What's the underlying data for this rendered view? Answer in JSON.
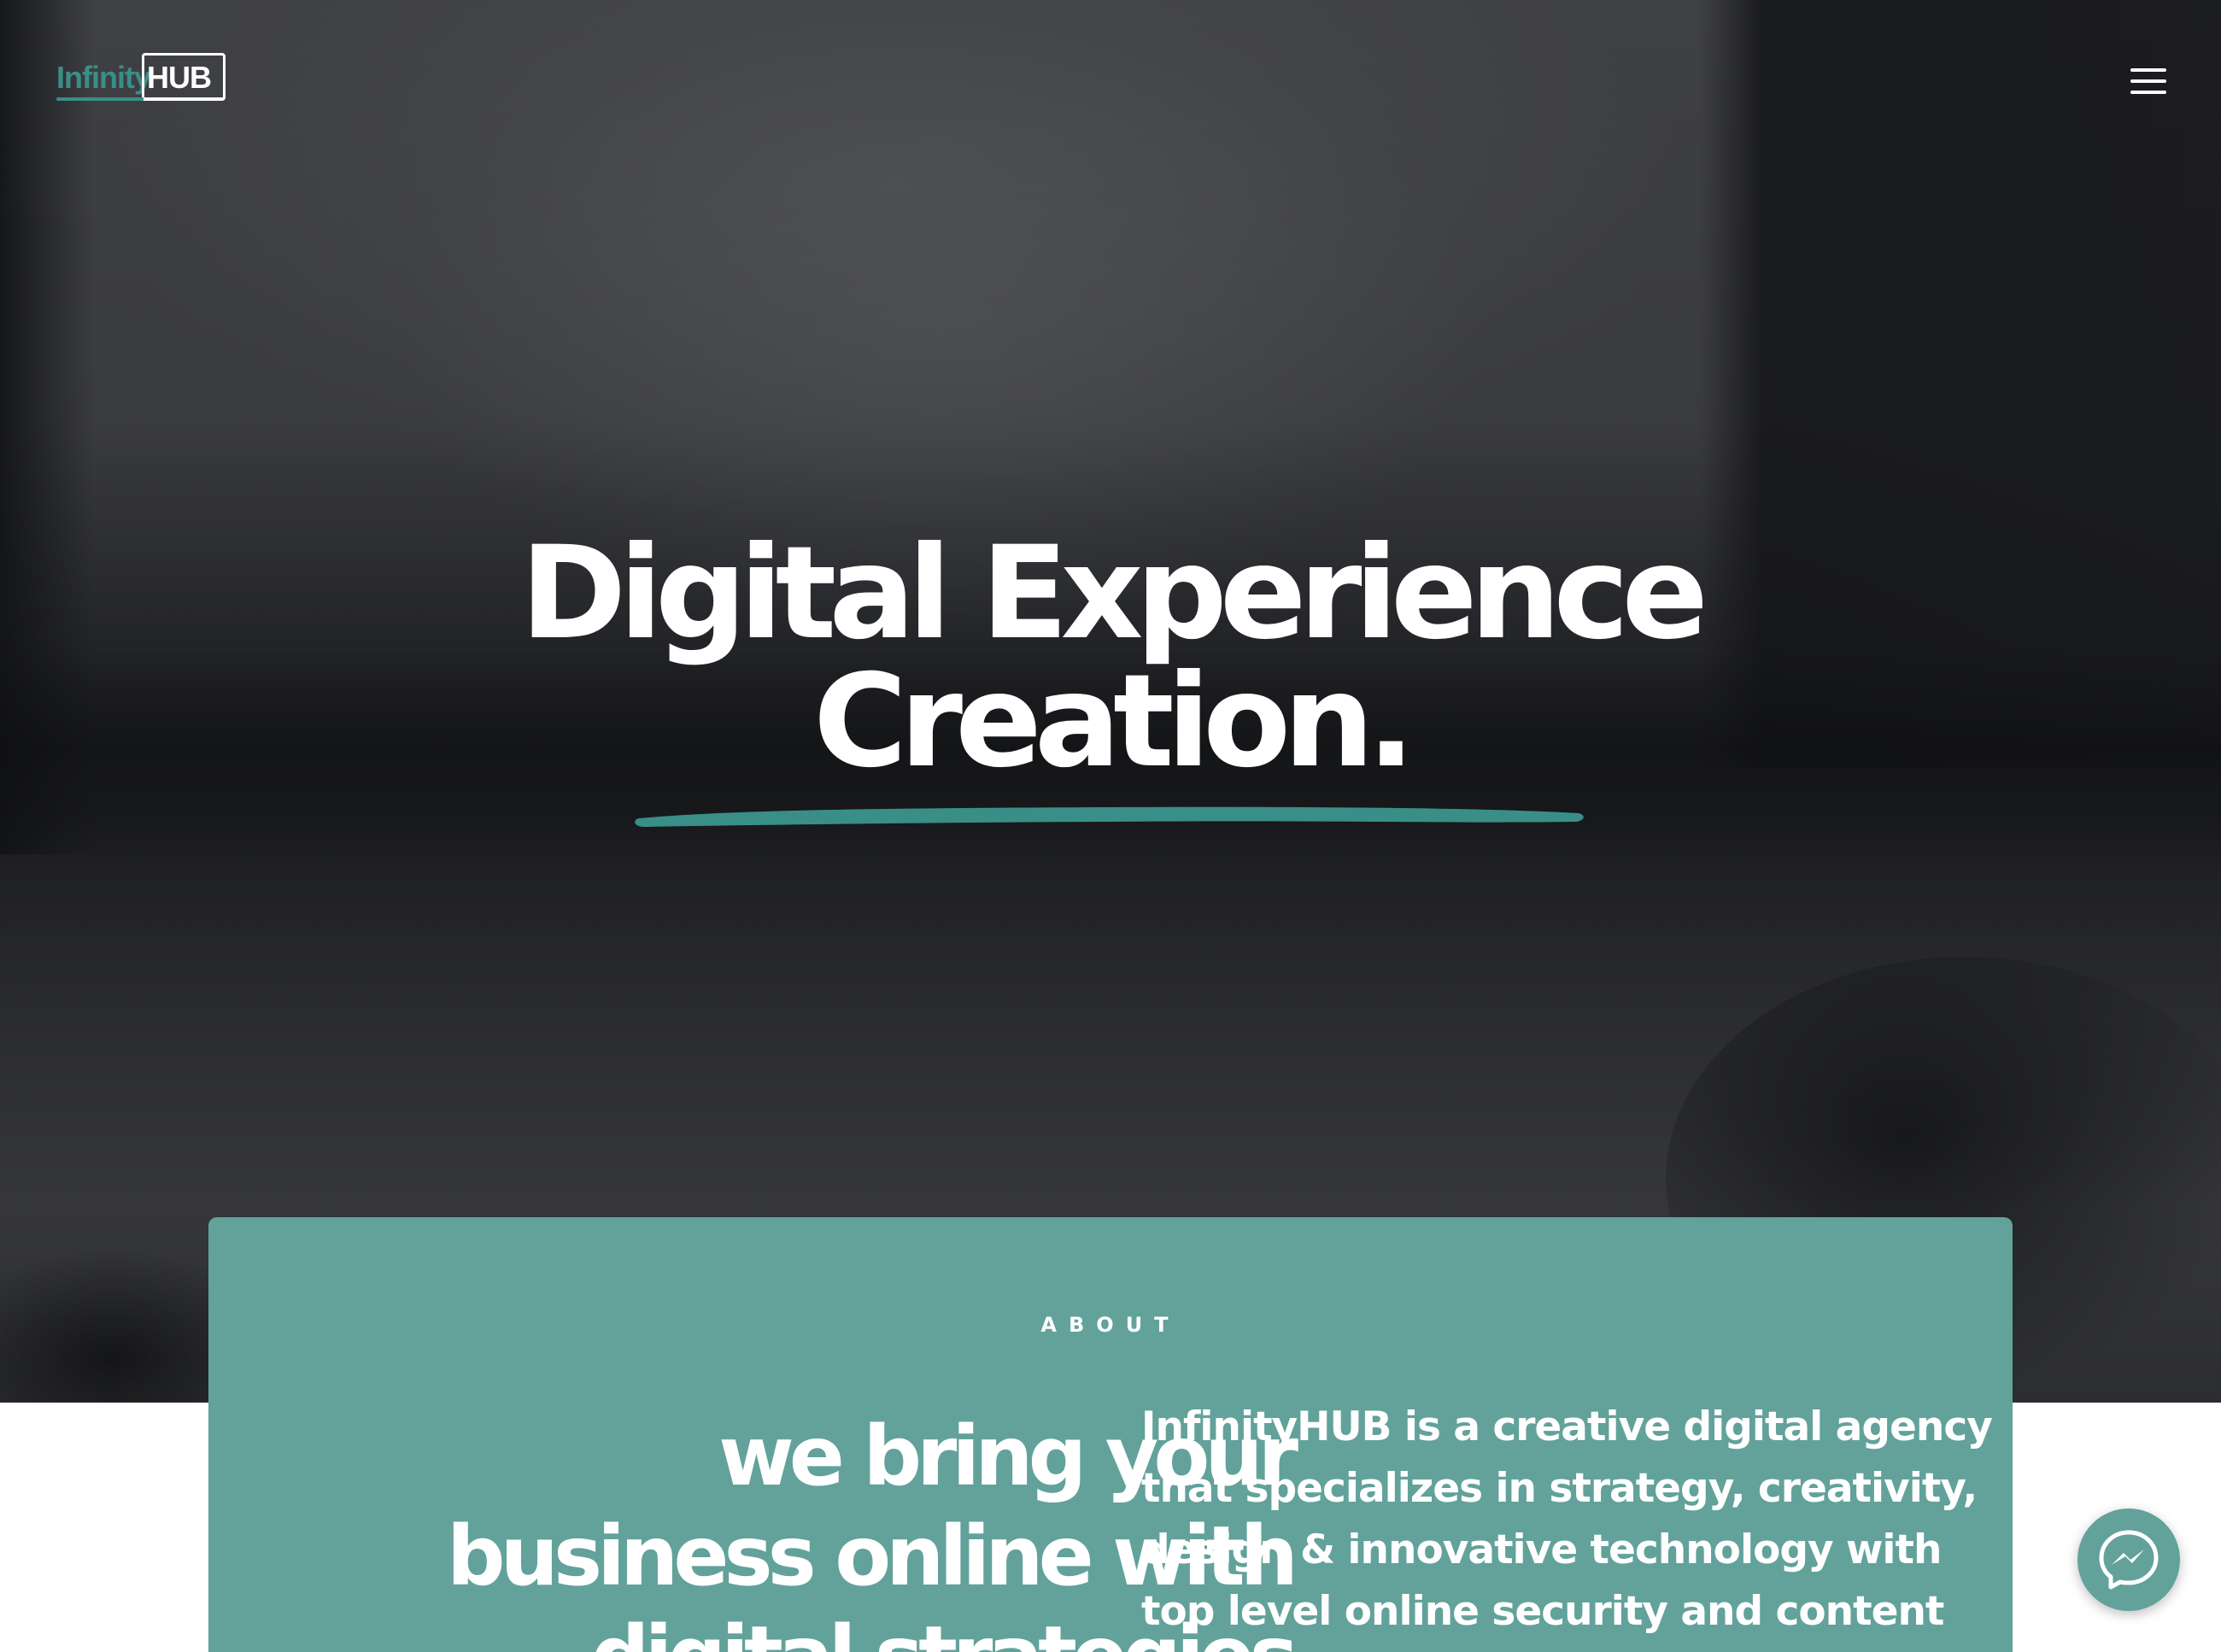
{
  "header": {
    "logo_text_left": "Infinity",
    "logo_text_right": "HUB",
    "menu_icon": "hamburger-menu-icon"
  },
  "hero": {
    "headline_line1": "Digital Experience",
    "headline_line2": "Creation."
  },
  "about": {
    "label": "ABOUT",
    "title": "we bring your\nbusiness online with\ndigital strategies",
    "text": "InfinityHUB is a creative digital agency that specializes in strategy, creativity, design & innovative technology with top level online security and content"
  },
  "chat": {
    "icon": "messenger-icon"
  },
  "colors": {
    "accent": "#62a29b",
    "accent_dark": "#3a8e88",
    "hero_dark": "#1b1c1f",
    "text_light": "#ffffff"
  }
}
